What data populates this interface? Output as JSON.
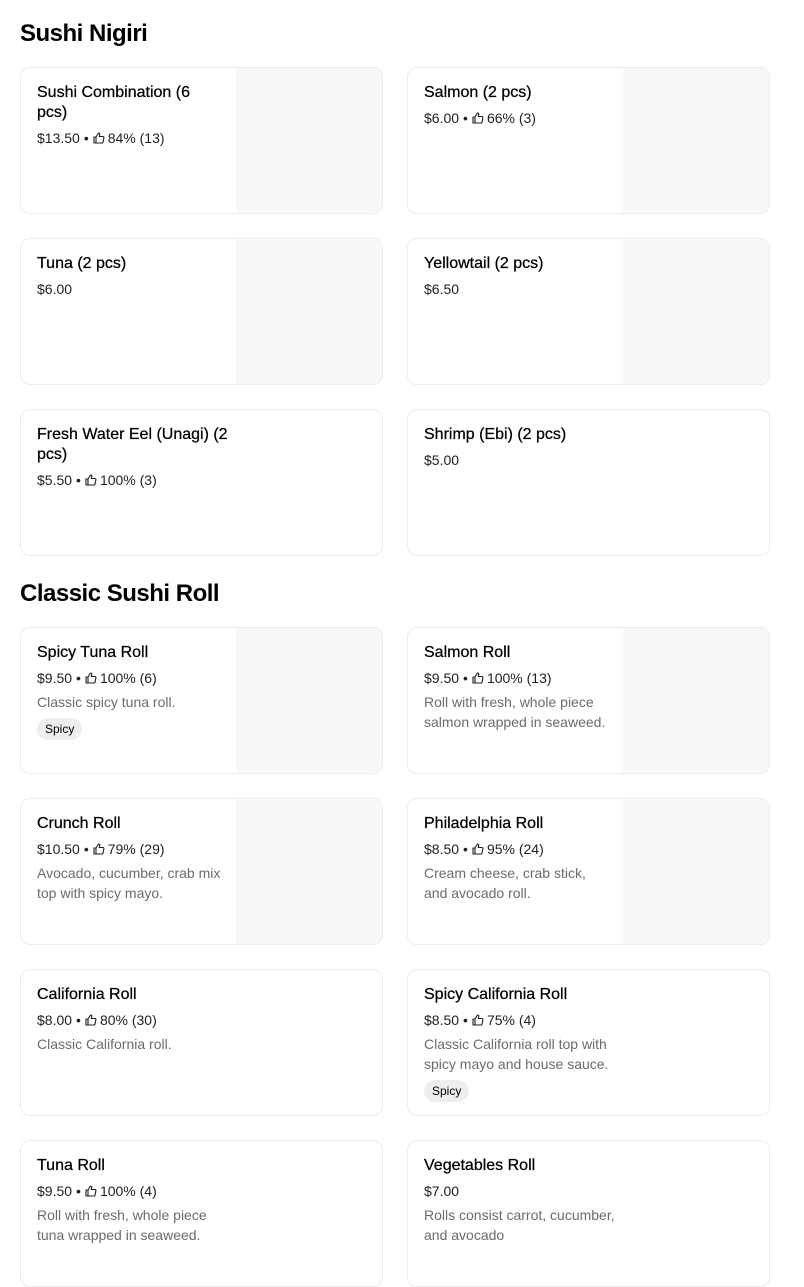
{
  "sections": [
    {
      "title": "Sushi Nigiri",
      "items": [
        {
          "name": "Sushi Combination (6 pcs)",
          "price": "$13.50",
          "rating": "84% (13)",
          "description": "",
          "badge": "",
          "has_image": true
        },
        {
          "name": "Salmon (2 pcs)",
          "price": "$6.00",
          "rating": "66% (3)",
          "description": "",
          "badge": "",
          "has_image": true
        },
        {
          "name": "Tuna (2 pcs)",
          "price": "$6.00",
          "rating": "",
          "description": "",
          "badge": "",
          "has_image": true
        },
        {
          "name": "Yellowtail (2 pcs)",
          "price": "$6.50",
          "rating": "",
          "description": "",
          "badge": "",
          "has_image": true
        },
        {
          "name": "Fresh Water Eel (Unagi) (2 pcs)",
          "price": "$5.50",
          "rating": "100% (3)",
          "description": "",
          "badge": "",
          "has_image": false
        },
        {
          "name": "Shrimp (Ebi) (2 pcs)",
          "price": "$5.00",
          "rating": "",
          "description": "",
          "badge": "",
          "has_image": false
        }
      ]
    },
    {
      "title": "Classic Sushi Roll",
      "items": [
        {
          "name": "Spicy Tuna Roll",
          "price": "$9.50",
          "rating": "100% (6)",
          "description": "Classic spicy tuna roll.",
          "badge": "Spicy",
          "has_image": true
        },
        {
          "name": "Salmon Roll",
          "price": "$9.50",
          "rating": "100% (13)",
          "description": "Roll with fresh, whole piece salmon wrapped in seaweed.",
          "badge": "",
          "has_image": true
        },
        {
          "name": "Crunch Roll",
          "price": "$10.50",
          "rating": "79% (29)",
          "description": "Avocado, cucumber, crab mix top with spicy mayo.",
          "badge": "",
          "has_image": true
        },
        {
          "name": "Philadelphia Roll",
          "price": "$8.50",
          "rating": "95% (24)",
          "description": "Cream cheese, crab stick, and avocado roll.",
          "badge": "",
          "has_image": true
        },
        {
          "name": "California Roll",
          "price": "$8.00",
          "rating": "80% (30)",
          "description": "Classic California roll.",
          "badge": "",
          "has_image": false
        },
        {
          "name": "Spicy California Roll",
          "price": "$8.50",
          "rating": "75% (4)",
          "description": "Classic California roll top with spicy mayo and house sauce.",
          "badge": "Spicy",
          "has_image": false
        },
        {
          "name": "Tuna Roll",
          "price": "$9.50",
          "rating": "100% (4)",
          "description": "Roll with fresh, whole piece tuna wrapped in seaweed.",
          "badge": "",
          "has_image": false
        },
        {
          "name": "Vegetables Roll",
          "price": "$7.00",
          "rating": "",
          "description": "Rolls consist carrot, cucumber, and avocado",
          "badge": "",
          "has_image": false
        }
      ]
    }
  ],
  "icons": {
    "rating": "thumbs-up-icon"
  }
}
